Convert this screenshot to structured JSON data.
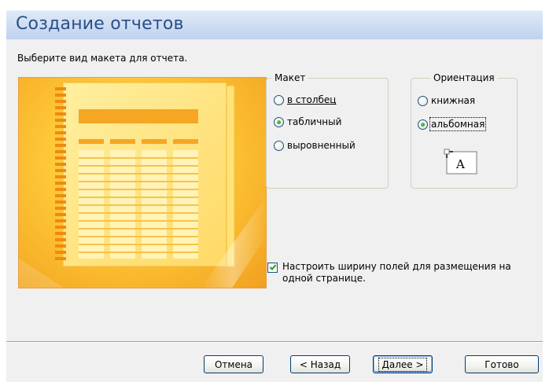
{
  "dialog": {
    "title": "Создание отчетов",
    "instruction": "Выберите вид макета для отчета."
  },
  "layout_group": {
    "legend": "Макет",
    "options": [
      {
        "label": "в столбец",
        "checked": false
      },
      {
        "label": "табличный",
        "checked": true
      },
      {
        "label": "выровненный",
        "checked": false
      }
    ]
  },
  "orientation_group": {
    "legend": "Ориентация",
    "options": [
      {
        "label": "книжная",
        "checked": false
      },
      {
        "label": "альбомная",
        "checked": true
      }
    ],
    "icon_glyph": "A"
  },
  "fit_checkbox": {
    "label": "Настроить ширину полей для размещения на одной странице.",
    "checked": true
  },
  "buttons": {
    "cancel": "Отмена",
    "back": "< Назад",
    "next": "Далее >",
    "finish": "Готово"
  },
  "colors": {
    "header_text": "#2a4f88",
    "preview_orange": "#f7b22a",
    "radio_dot": "#21a121"
  }
}
